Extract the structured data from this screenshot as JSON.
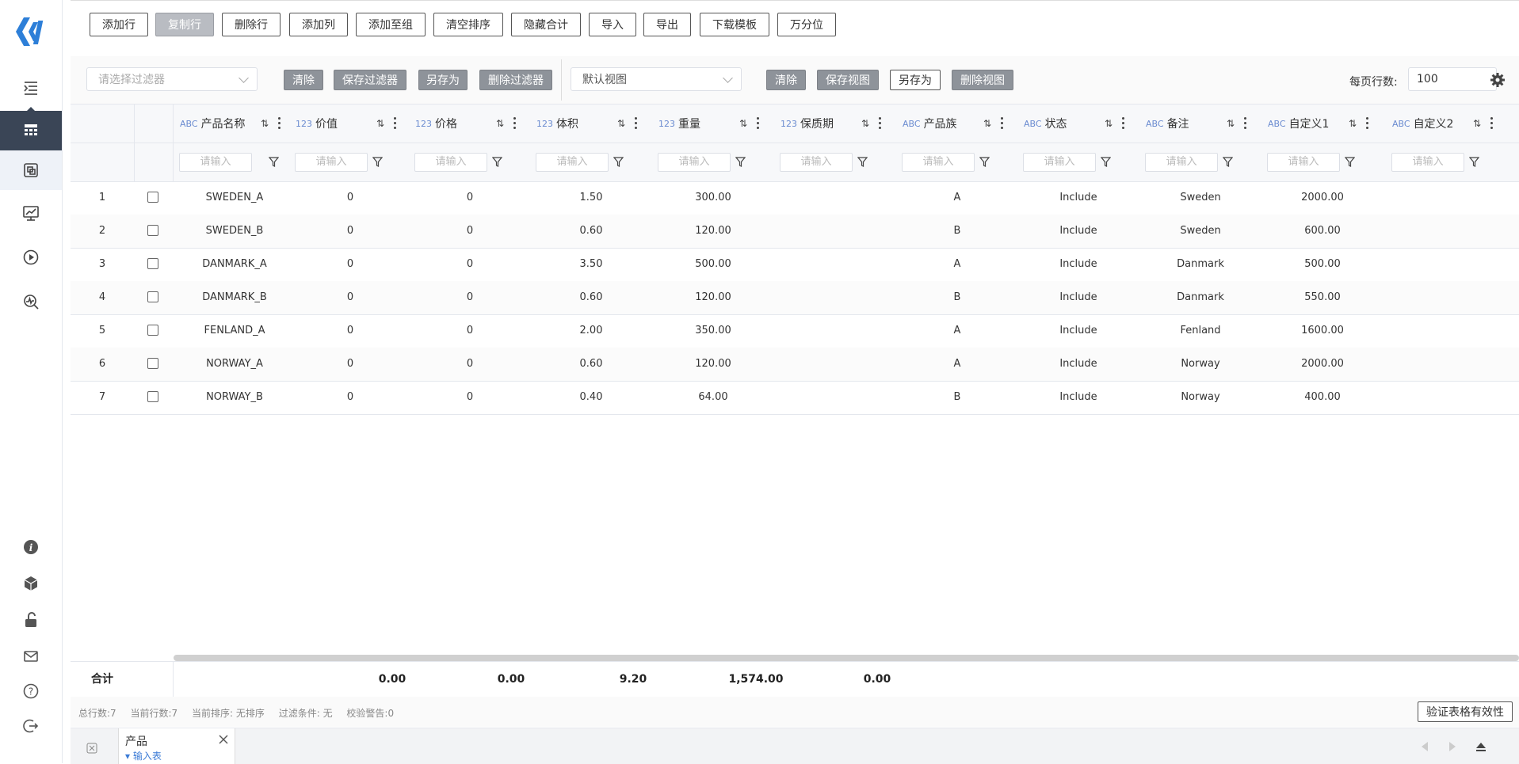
{
  "toolbar": {
    "buttons": [
      "添加行",
      "复制行",
      "删除行",
      "添加列",
      "添加至组",
      "清空排序",
      "隐藏合计",
      "导入",
      "导出",
      "下载模板",
      "万分位"
    ]
  },
  "filterbar": {
    "filter_placeholder": "请选择过滤器",
    "clear1": "清除",
    "save_filter": "保存过滤器",
    "save_as1": "另存为",
    "delete_filter": "删除过滤器",
    "view_value": "默认视图",
    "clear2": "清除",
    "save_view": "保存视图",
    "save_as2": "另存为",
    "delete_view": "删除视图",
    "page_size_label": "每页行数:",
    "page_size_value": "100"
  },
  "grid": {
    "columns": [
      {
        "type": "ABC",
        "label": "产品名称"
      },
      {
        "type": "123",
        "label": "价值"
      },
      {
        "type": "123",
        "label": "价格"
      },
      {
        "type": "123",
        "label": "体积"
      },
      {
        "type": "123",
        "label": "重量"
      },
      {
        "type": "123",
        "label": "保质期"
      },
      {
        "type": "ABC",
        "label": "产品族"
      },
      {
        "type": "ABC",
        "label": "状态"
      },
      {
        "type": "ABC",
        "label": "备注"
      },
      {
        "type": "ABC",
        "label": "自定义1"
      },
      {
        "type": "ABC",
        "label": "自定义2"
      }
    ],
    "filter_placeholder": "请输入",
    "rows": [
      {
        "n": "1",
        "name": "SWEDEN_A",
        "value": "0",
        "price": "0",
        "volume": "1.50",
        "weight": "300.00",
        "shelf": "",
        "family": "A",
        "status": "Include",
        "note": "Sweden",
        "c1": "2000.00",
        "c2": ""
      },
      {
        "n": "2",
        "name": "SWEDEN_B",
        "value": "0",
        "price": "0",
        "volume": "0.60",
        "weight": "120.00",
        "shelf": "",
        "family": "B",
        "status": "Include",
        "note": "Sweden",
        "c1": "600.00",
        "c2": ""
      },
      {
        "n": "3",
        "name": "DANMARK_A",
        "value": "0",
        "price": "0",
        "volume": "3.50",
        "weight": "500.00",
        "shelf": "",
        "family": "A",
        "status": "Include",
        "note": "Danmark",
        "c1": "500.00",
        "c2": ""
      },
      {
        "n": "4",
        "name": "DANMARK_B",
        "value": "0",
        "price": "0",
        "volume": "0.60",
        "weight": "120.00",
        "shelf": "",
        "family": "B",
        "status": "Include",
        "note": "Danmark",
        "c1": "550.00",
        "c2": ""
      },
      {
        "n": "5",
        "name": "FENLAND_A",
        "value": "0",
        "price": "0",
        "volume": "2.00",
        "weight": "350.00",
        "shelf": "",
        "family": "A",
        "status": "Include",
        "note": "Fenland",
        "c1": "1600.00",
        "c2": ""
      },
      {
        "n": "6",
        "name": "NORWAY_A",
        "value": "0",
        "price": "0",
        "volume": "0.60",
        "weight": "120.00",
        "shelf": "",
        "family": "A",
        "status": "Include",
        "note": "Norway",
        "c1": "2000.00",
        "c2": ""
      },
      {
        "n": "7",
        "name": "NORWAY_B",
        "value": "0",
        "price": "0",
        "volume": "0.40",
        "weight": "64.00",
        "shelf": "",
        "family": "B",
        "status": "Include",
        "note": "Norway",
        "c1": "400.00",
        "c2": ""
      }
    ]
  },
  "totals": {
    "label": "合计",
    "value": "0.00",
    "price": "0.00",
    "volume": "9.20",
    "weight": "1,574.00",
    "shelf": "0.00"
  },
  "status": {
    "total_rows": "总行数:7",
    "current_rows": "当前行数:7",
    "current_sort": "当前排序: 无排序",
    "filter_cond": "过滤条件: 无",
    "check_warn": "校验警告:0",
    "validate_btn": "验证表格有效性"
  },
  "tab": {
    "title": "产品",
    "sub": "▾ 输入表"
  },
  "colors": {
    "sidebar_active": "#3a4556",
    "accent_blue": "#3b7bd6",
    "type_label": "#6a8bd0"
  }
}
